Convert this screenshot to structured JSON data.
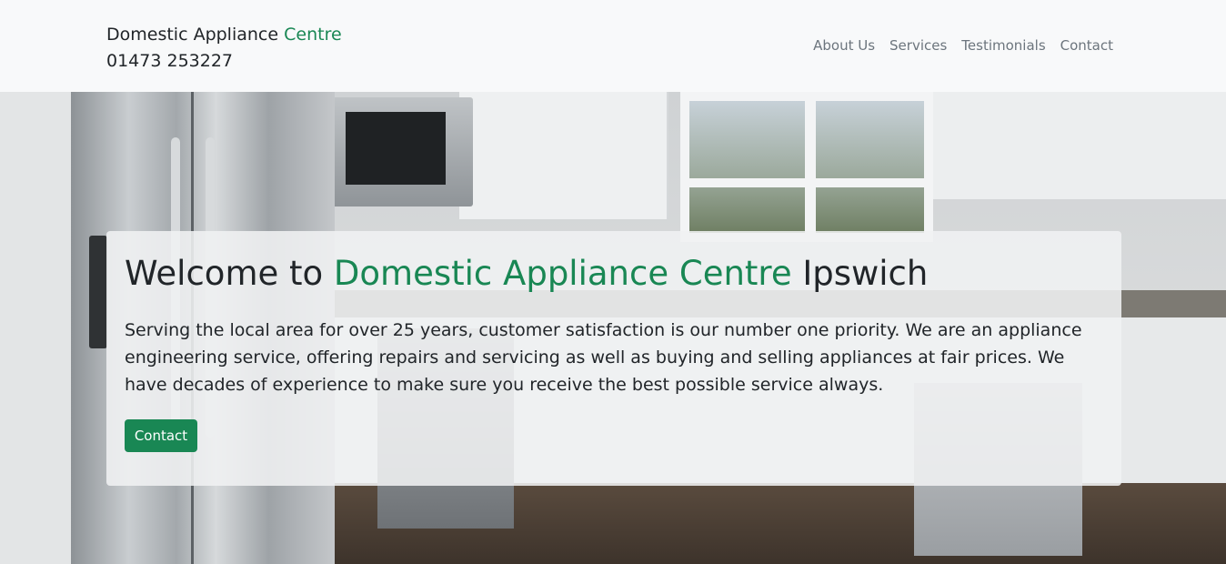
{
  "navbar": {
    "brand_prefix": "Domestic Appliance",
    "brand_accent": "Centre",
    "phone": "01473 253227",
    "links": [
      {
        "label": "About Us"
      },
      {
        "label": "Services"
      },
      {
        "label": "Testimonials"
      },
      {
        "label": "Contact"
      }
    ]
  },
  "hero": {
    "title_prefix": "Welcome to",
    "title_accent": "Domestic Appliance Centre",
    "title_suffix": "Ipswich",
    "lead": "Serving the local area for over 25 years, customer satisfaction is our number one priority. We are an appliance engineering service, offering repairs and servicing as well as buying and selling appliances at fair prices. We have decades of experience to make sure you receive the best possible service always.",
    "button_label": "Contact"
  },
  "colors": {
    "accent": "#198754",
    "navbar_bg": "#f8f9fa",
    "text": "#212529",
    "nav_link": "#6c757d"
  }
}
